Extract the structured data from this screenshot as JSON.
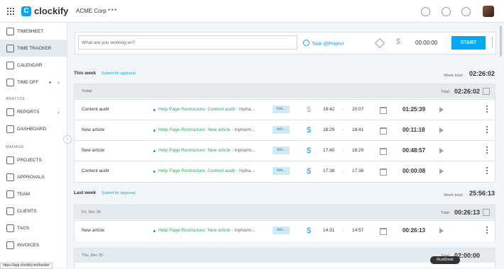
{
  "app": {
    "name": "clockify",
    "workspace": "ACME Corp",
    "menu_dots": "•••"
  },
  "colors": {
    "accent": "#03a9f4",
    "project": "#2da866",
    "sidebar_active": "#e4eaee"
  },
  "icons": [
    "grid-icon",
    "help-icon",
    "notification-icon",
    "question-icon",
    "avatar",
    "tag-icon",
    "money-icon",
    "calendar-icon",
    "play-icon",
    "more-icon",
    "copy-icon"
  ],
  "sidebar": {
    "items": [
      {
        "label": "TIMESHEET"
      },
      {
        "label": "TIME TRACKER"
      },
      {
        "label": "CALENDAR"
      },
      {
        "label": "TIME OFF"
      },
      {
        "label": "REPORTS"
      },
      {
        "label": "DASHBOARD"
      },
      {
        "label": "PROJECTS"
      },
      {
        "label": "APPROVALS"
      },
      {
        "label": "TEAM"
      },
      {
        "label": "CLIENTS"
      },
      {
        "label": "TAGS"
      },
      {
        "label": "INVOICES"
      }
    ],
    "sections": {
      "analyze": "ANALYZE",
      "manage": "MANAGE"
    },
    "collapse": "‹"
  },
  "tracker": {
    "placeholder": "What are you working on?",
    "task_project": "Task @Project",
    "time": "00:00:00",
    "start_label": "START"
  },
  "this_week": {
    "title": "This week",
    "submit": "Submit for approval",
    "total_label": "Week total:",
    "total": "02:26:02",
    "group": {
      "label": "Today",
      "total_label": "Total:",
      "total": "02:26:02"
    },
    "entries": [
      {
        "description": "Content audit",
        "project": "Help Page Restructure: Content audit",
        "client": "- Inpha...",
        "tag": "#int...",
        "billable": false,
        "start": "18:42",
        "end": "20:07",
        "duration": "01:25:39"
      },
      {
        "description": "New article",
        "project": "Help Page Restructure: New article",
        "client": "- Inpharm...",
        "tag": "#cli...",
        "billable": true,
        "start": "18:29",
        "end": "18:41",
        "duration": "00:11:18"
      },
      {
        "description": "New article",
        "project": "Help Page Restructure: New article",
        "client": "- Inpharm...",
        "tag": "#cli...",
        "billable": true,
        "start": "17:40",
        "end": "18:29",
        "duration": "00:48:57"
      },
      {
        "description": "Content audit",
        "project": "Help Page Restructure: Content audit",
        "client": "- Inpha...",
        "tag": "#int...",
        "billable": true,
        "start": "17:38",
        "end": "17:38",
        "duration": "00:00:08"
      }
    ]
  },
  "last_week": {
    "title": "Last week",
    "submit": "Submit for approval",
    "total_label": "Week total:",
    "total": "25:56:13",
    "group": {
      "label": "Fri, Dec 26",
      "total_label": "Total:",
      "total": "00:26:13"
    },
    "entries": [
      {
        "description": "New article",
        "project": "Help Page Restructure: New article",
        "client": "- Inpharm...",
        "tag": "#cli...",
        "billable": true,
        "start": "14:31",
        "end": "14:57",
        "duration": "00:26:13"
      }
    ],
    "next_group": {
      "label": "Thu, Dec 25",
      "total_label": "Total:",
      "total": "02:00:00"
    }
  },
  "footer": {
    "url": "https://app.clockify.me/tracker",
    "tooltip": "RustDesk"
  }
}
